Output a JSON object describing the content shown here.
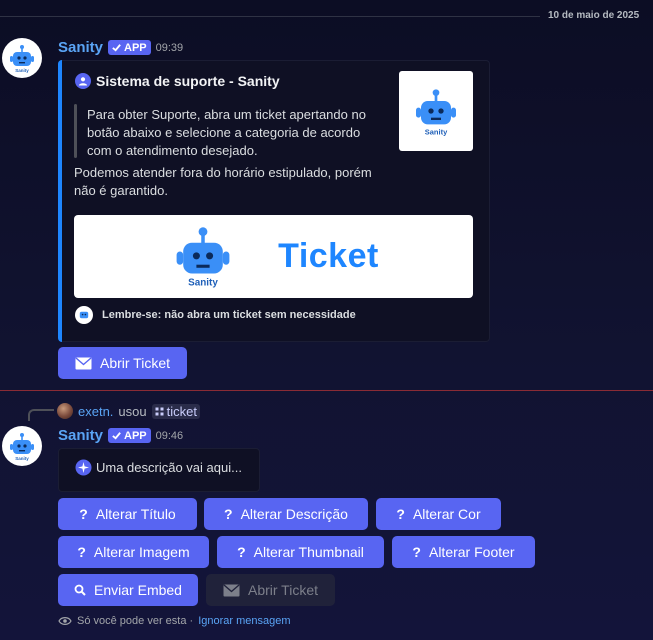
{
  "date_divider": "10 de maio de 2025",
  "message1": {
    "username": "Sanity",
    "badge": "APP",
    "time": "09:39",
    "embed": {
      "author": "Sistema de suporte - Sanity",
      "quote": "Para obter Suporte, abra um ticket apertando no botão abaixo e selecione a categoria de acordo com o atendimento desejado.",
      "description": "Podemos atender fora do horário estipulado, porém não é garantido.",
      "thumbnail_brand": "Sanity",
      "banner_brand": "Sanity",
      "banner_title": "Ticket",
      "footer": "Lembre-se: não abra um ticket sem necessidade"
    },
    "button": "Abrir Ticket"
  },
  "message2": {
    "reply": {
      "user": "exetn.",
      "action": "usou",
      "command": "ticket"
    },
    "username": "Sanity",
    "badge": "APP",
    "time": "09:46",
    "embed_description": "Uma descrição vai aqui...",
    "buttons": {
      "alterar_titulo": "Alterar Título",
      "alterar_descricao": "Alterar Descrição",
      "alterar_cor": "Alterar Cor",
      "alterar_imagem": "Alterar Imagem",
      "alterar_thumbnail": "Alterar Thumbnail",
      "alterar_footer": "Alterar Footer",
      "enviar_embed": "Enviar Embed",
      "abrir_ticket": "Abrir Ticket"
    },
    "ephemeral_notice": "Só você pode ver esta ·",
    "ephemeral_link": "Ignorar mensagem"
  },
  "colors": {
    "accent": "#5865f2",
    "embed_bar": "#1e86ff",
    "username": "#5aa4f5",
    "new_divider": "#8a2b35"
  },
  "icons": [
    "robot-icon",
    "check-icon",
    "envelope-icon",
    "question-icon",
    "search-icon",
    "sparkle-icon",
    "eye-icon",
    "slash-command-icon"
  ]
}
